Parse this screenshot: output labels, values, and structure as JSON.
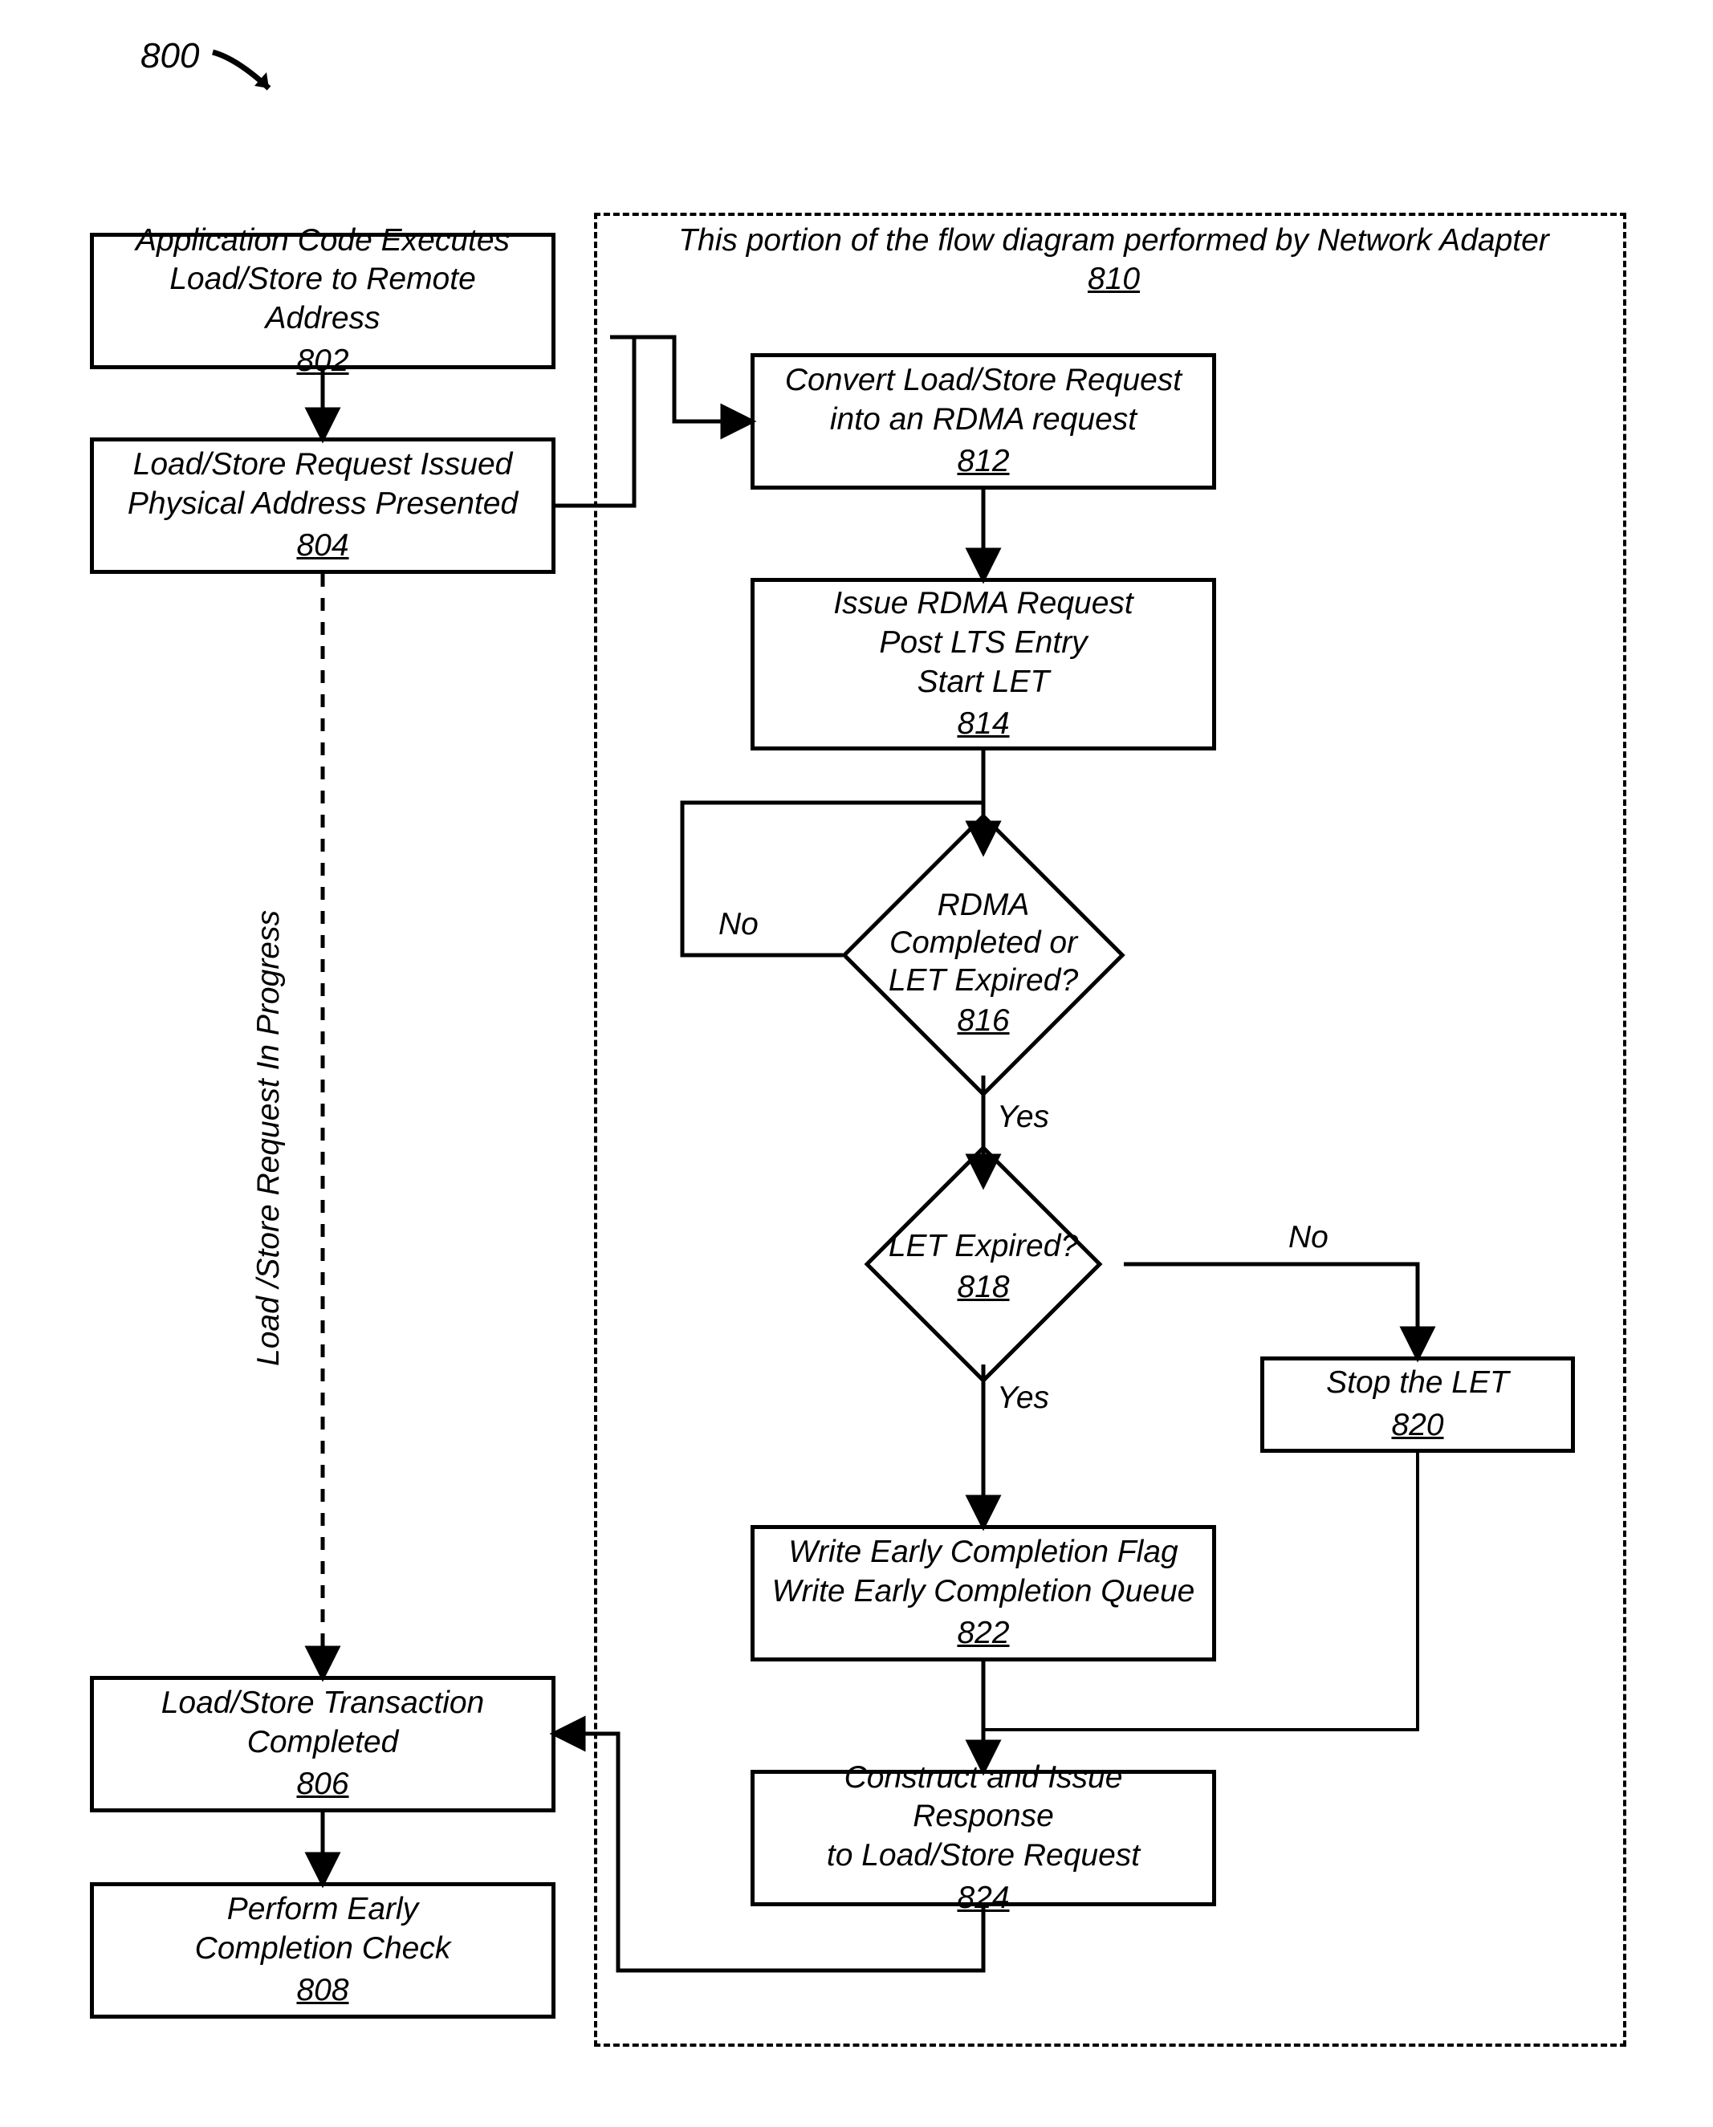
{
  "figure": {
    "label": "800"
  },
  "container": {
    "title": "This portion of the flow diagram performed by Network Adapter",
    "ref": "810"
  },
  "nodes": {
    "n802": {
      "lines": [
        "Application Code Executes",
        "Load/Store to Remote Address"
      ],
      "ref": "802"
    },
    "n804": {
      "lines": [
        "Load/Store Request Issued",
        "Physical Address Presented"
      ],
      "ref": "804"
    },
    "n806": {
      "lines": [
        "Load/Store Transaction",
        "Completed"
      ],
      "ref": "806"
    },
    "n808": {
      "lines": [
        "Perform Early",
        "Completion Check"
      ],
      "ref": "808"
    },
    "n812": {
      "lines": [
        "Convert Load/Store Request",
        "into an RDMA request"
      ],
      "ref": "812"
    },
    "n814": {
      "lines": [
        "Issue RDMA Request",
        "Post LTS Entry",
        "Start LET"
      ],
      "ref": "814"
    },
    "n816": {
      "lines": [
        "RDMA",
        "Completed or",
        "LET Expired?"
      ],
      "ref": "816"
    },
    "n818": {
      "lines": [
        "LET Expired?"
      ],
      "ref": "818"
    },
    "n820": {
      "lines": [
        "Stop the LET"
      ],
      "ref": "820"
    },
    "n822": {
      "lines": [
        "Write Early Completion Flag",
        "Write Early Completion Queue"
      ],
      "ref": "822"
    },
    "n824": {
      "lines": [
        "Construct and Issue Response",
        "to Load/Store Request"
      ],
      "ref": "824"
    }
  },
  "edgeLabels": {
    "e816_no": "No",
    "e816_yes": "Yes",
    "e818_no": "No",
    "e818_yes": "Yes"
  },
  "sideLabel": "Load /Store Request In Progress"
}
